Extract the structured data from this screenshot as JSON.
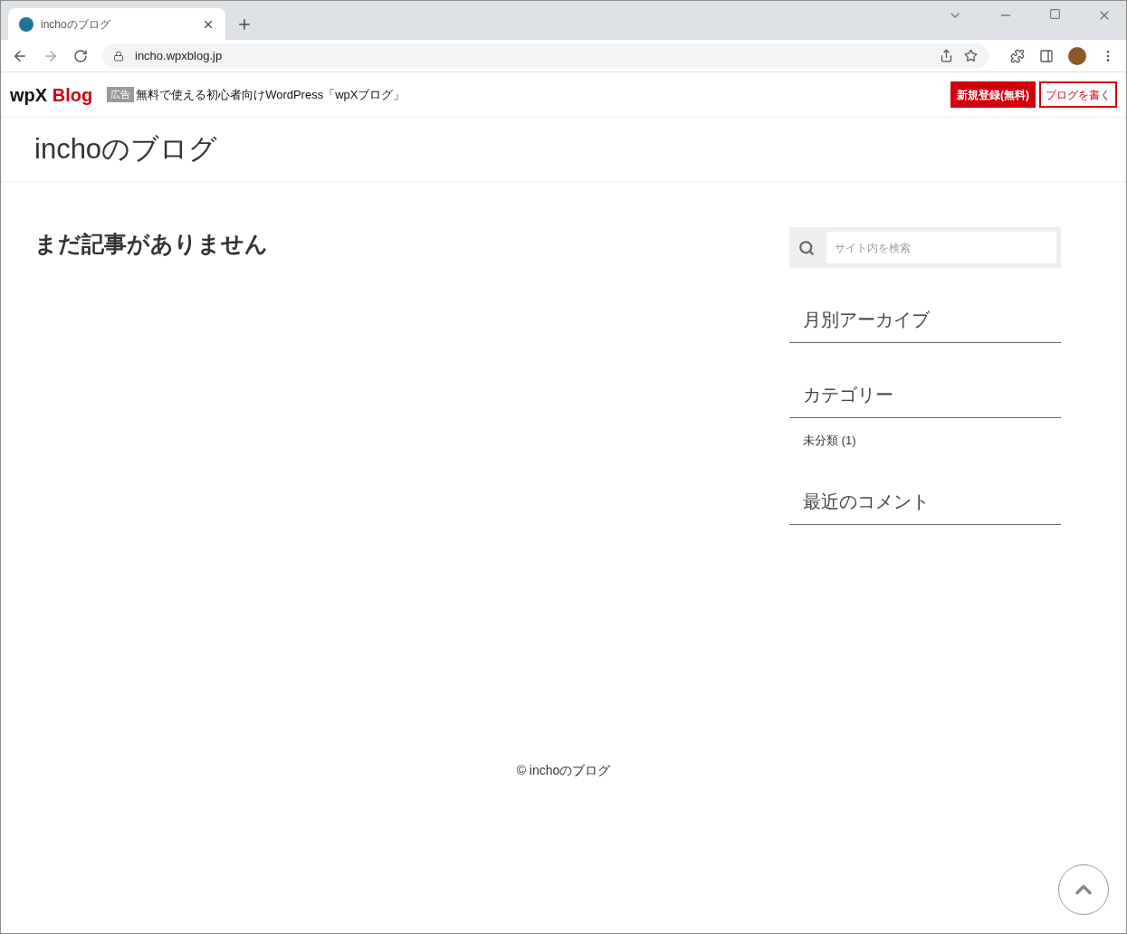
{
  "browser": {
    "tab": {
      "title": "inchoのブログ",
      "selected": true
    },
    "url": "incho.wpxblog.jp"
  },
  "ad_bar": {
    "logo_left": "wpX",
    "logo_right": "Blog",
    "ad_badge": "広告",
    "ad_text": "無料で使える初心者向けWordPress「wpXブログ」",
    "buttons": [
      {
        "label": "新規登録(無料)",
        "kind": "filled"
      },
      {
        "label": "ブログを書く",
        "kind": "outline"
      }
    ]
  },
  "site": {
    "title": "inchoのブログ"
  },
  "main": {
    "heading": "まだ記事がありません"
  },
  "sidebar": {
    "search": {
      "placeholder": "サイト内を検索"
    },
    "widgets": [
      {
        "title": "月別アーカイブ"
      },
      {
        "title": "カテゴリー",
        "items": [
          "未分類 (1)"
        ]
      },
      {
        "title": "最近のコメント"
      }
    ]
  },
  "footer": {
    "copyright": "© inchoのブログ"
  }
}
